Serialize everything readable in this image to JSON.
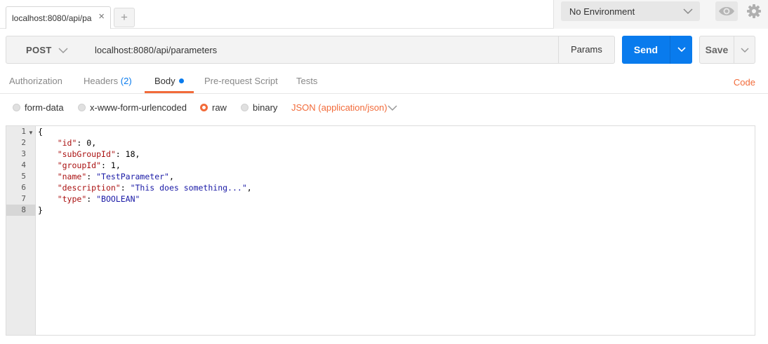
{
  "tab": {
    "label": "localhost:8080/api/pa",
    "close": "×"
  },
  "new_tab": "+",
  "environment": {
    "selected": "No Environment"
  },
  "request": {
    "method": "POST",
    "url": "localhost:8080/api/parameters",
    "params_label": "Params",
    "send_label": "Send",
    "save_label": "Save"
  },
  "request_tabs": {
    "authorization": "Authorization",
    "headers": "Headers",
    "headers_count": "(2)",
    "body": "Body",
    "pre_request": "Pre-request Script",
    "tests": "Tests",
    "code": "Code"
  },
  "body_types": {
    "form_data": "form-data",
    "urlencoded": "x-www-form-urlencoded",
    "raw": "raw",
    "binary": "binary",
    "content_type": "JSON (application/json)",
    "selected": "raw"
  },
  "editor": {
    "line_numbers": [
      "1",
      "2",
      "3",
      "4",
      "5",
      "6",
      "7",
      "8"
    ],
    "lines": {
      "open": "{",
      "id_key": "\"id\"",
      "id_val": "0",
      "subgroup_key": "\"subGroupId\"",
      "subgroup_val": "18",
      "group_key": "\"groupId\"",
      "group_val": "1",
      "name_key": "\"name\"",
      "name_val": "\"TestParameter\"",
      "desc_key": "\"description\"",
      "desc_val": "\"This does something...\"",
      "type_key": "\"type\"",
      "type_val": "\"BOOLEAN\"",
      "close": "}"
    }
  },
  "colors": {
    "accent": "#f26b3a",
    "primary": "#097bed",
    "json_key": "#aa1111",
    "json_string": "#1a1aa6"
  }
}
